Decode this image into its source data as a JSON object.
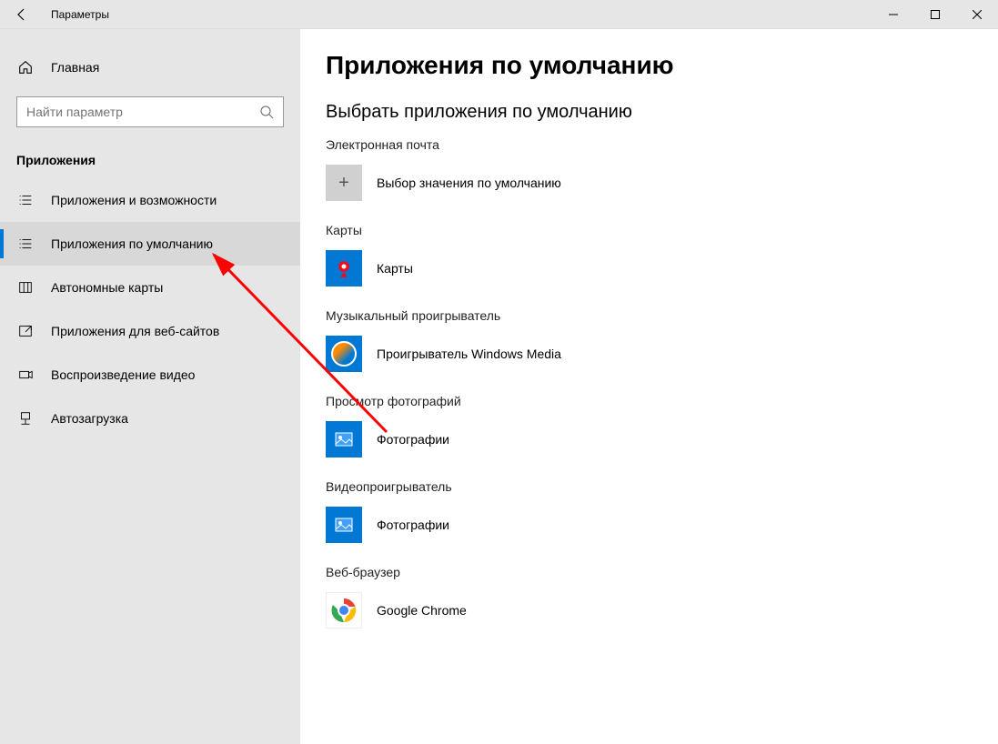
{
  "window": {
    "title": "Параметры"
  },
  "sidebar": {
    "home": "Главная",
    "search_placeholder": "Найти параметр",
    "heading": "Приложения",
    "items": [
      {
        "label": "Приложения и возможности"
      },
      {
        "label": "Приложения по умолчанию"
      },
      {
        "label": "Автономные карты"
      },
      {
        "label": "Приложения для веб-сайтов"
      },
      {
        "label": "Воспроизведение видео"
      },
      {
        "label": "Автозагрузка"
      }
    ],
    "active_index": 1
  },
  "page": {
    "title": "Приложения по умолчанию",
    "section_title": "Выбрать приложения по умолчанию",
    "defaults": [
      {
        "category": "Электронная почта",
        "app": "Выбор значения по умолчанию",
        "icon": "plus"
      },
      {
        "category": "Карты",
        "app": "Карты",
        "icon": "maps"
      },
      {
        "category": "Музыкальный проигрыватель",
        "app": "Проигрыватель Windows Media",
        "icon": "wmp"
      },
      {
        "category": "Просмотр фотографий",
        "app": "Фотографии",
        "icon": "photos"
      },
      {
        "category": "Видеопроигрыватель",
        "app": "Фотографии",
        "icon": "photos"
      },
      {
        "category": "Веб-браузер",
        "app": "Google Chrome",
        "icon": "chrome"
      }
    ]
  }
}
